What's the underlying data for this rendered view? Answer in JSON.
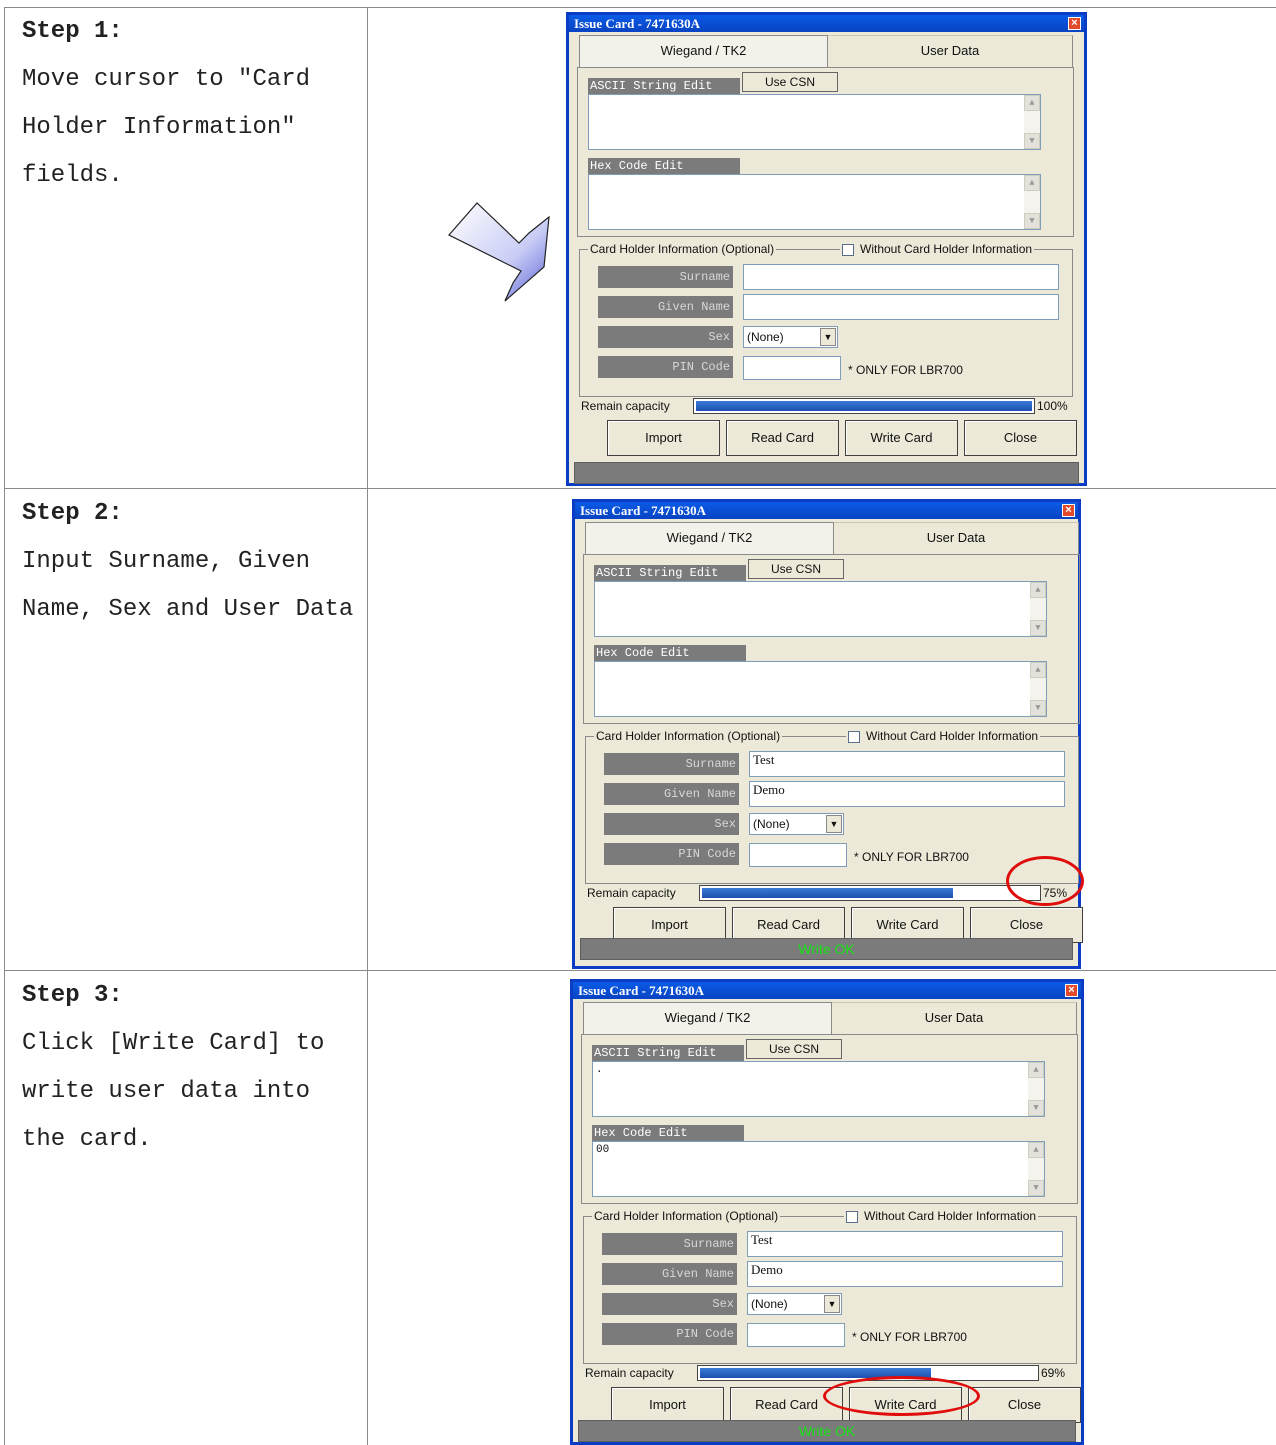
{
  "dialog": {
    "title": "Issue Card - 7471630A",
    "close_glyph": "×",
    "tabs": [
      "Wiegand / TK2",
      "User Data"
    ],
    "ascii_label": "ASCII String Edit",
    "use_csn_label": "Use CSN",
    "hex_label": "Hex Code Edit",
    "group_label": "Card Holder Information (Optional)",
    "without_label": "Without Card Holder Information",
    "surname_label": "Surname",
    "given_label": "Given Name",
    "sex_label": "Sex",
    "pin_label": "PIN Code",
    "pin_note": "* ONLY FOR LBR700",
    "remain_label": "Remain capacity",
    "buttons": {
      "import": "Import",
      "read": "Read Card",
      "write": "Write Card",
      "close": "Close"
    }
  },
  "steps": [
    {
      "title": "Step 1:",
      "body": "Move cursor to \"Card\nHolder Information\"\nfields.",
      "ascii_value": "",
      "hex_value": "",
      "surname": "",
      "given_name": "",
      "sex": "(None)",
      "capacity_pct": 100,
      "capacity_text": "100%",
      "status": ""
    },
    {
      "title": "Step 2:",
      "body": "Input Surname, Given\nName, Sex and User Data",
      "ascii_value": "",
      "hex_value": "",
      "surname": "Test",
      "given_name": "Demo",
      "sex": "(None)",
      "capacity_pct": 75,
      "capacity_text": "75%",
      "status": "Write OK"
    },
    {
      "title": "Step 3:",
      "body": "Click [Write Card] to\nwrite user data into\nthe card.",
      "ascii_value": ".",
      "hex_value": "00",
      "surname": "Test",
      "given_name": "Demo",
      "sex": "(None)",
      "capacity_pct": 69,
      "capacity_text": "69%",
      "status": "Write OK"
    }
  ],
  "colors": {
    "annotation": "#e00d0d",
    "status_ok": "#16e316",
    "title_bar": "#0a5be6"
  }
}
